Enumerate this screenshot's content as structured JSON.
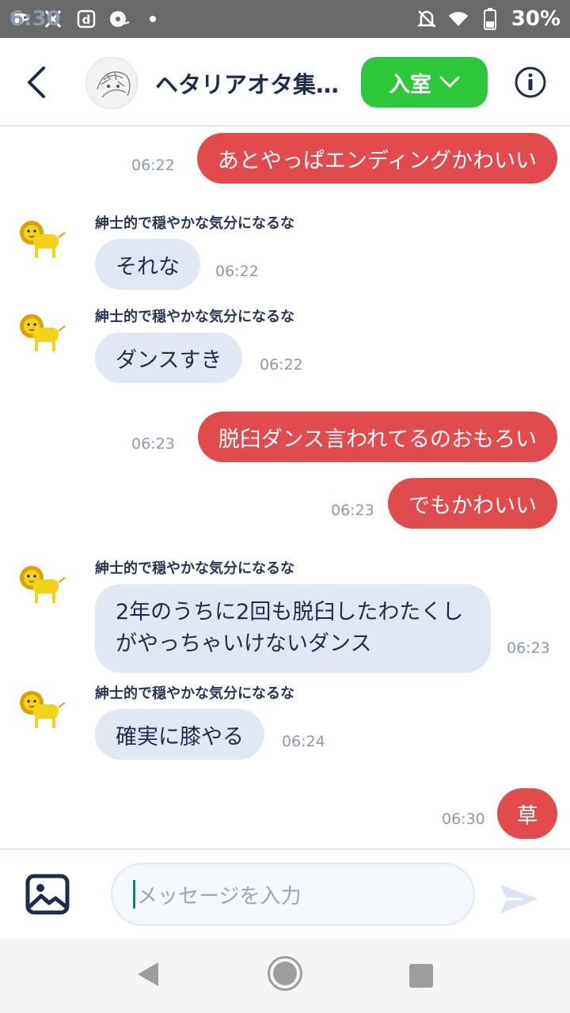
{
  "status_bar": {
    "time": "6:30",
    "battery": "30%",
    "icons": [
      "coffee-icon",
      "x-icon",
      "d-app-icon",
      "media-icon",
      "dot-icon",
      "bell-off-icon",
      "wifi-icon",
      "battery-icon"
    ]
  },
  "header": {
    "title": "ヘタリアオタ集…",
    "join_label": "入室"
  },
  "colors": {
    "accent_green": "#2ec73a",
    "outgoing_bubble": "#e24b4b",
    "incoming_bubble": "#e1e8f3",
    "navy": "#1f2d4a"
  },
  "messages": [
    {
      "side": "out",
      "text": "あとやっぱエンディングかわいい",
      "time": "06:22"
    },
    {
      "side": "in",
      "sender": "紳士的で穏やかな気分になるな",
      "text": "それな",
      "time": "06:22"
    },
    {
      "side": "in",
      "sender": "紳士的で穏やかな気分になるな",
      "text": "ダンスすき",
      "time": "06:22"
    },
    {
      "side": "out",
      "text": "脱臼ダンス言われてるのおもろい",
      "time": "06:23"
    },
    {
      "side": "out",
      "text": "でもかわいい",
      "time": "06:23"
    },
    {
      "side": "in",
      "sender": "紳士的で穏やかな気分になるな",
      "text_line1": "2年のうちに2回も脱臼したわたくし",
      "text_line2": "がやっちゃいけないダンス",
      "time": "06:23"
    },
    {
      "side": "in",
      "sender": "紳士的で穏やかな気分になるな",
      "text": "確実に膝やる",
      "time": "06:24"
    },
    {
      "side": "out",
      "text": "草",
      "time": "06:30"
    }
  ],
  "input": {
    "placeholder": "メッセージを入力"
  }
}
